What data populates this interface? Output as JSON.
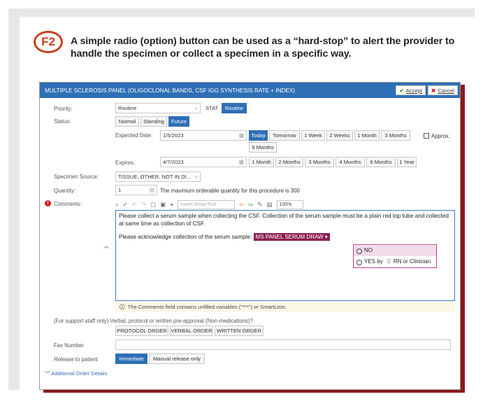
{
  "figure": {
    "badge": "F2",
    "caption": "A simple radio (option) button can be used as a “hard-stop” to alert the provider to handle the specimen or collect a specimen in a specific way."
  },
  "order": {
    "title": "MULTIPLE SCLEROSIS PANEL (OLIGOCLONAL BANDS, CSF IGG SYNTHESIS RATE + INDEX)",
    "accept_label": "Accept",
    "cancel_label": "Cancel",
    "priority": {
      "label": "Priority:",
      "value": "Routine",
      "buttons": [
        "STAT",
        "Routine"
      ],
      "selected": "Routine"
    },
    "status": {
      "label": "Status:",
      "buttons": [
        "Normal",
        "Standing",
        "Future"
      ],
      "selected": "Future"
    },
    "expected_date": {
      "label": "Expected Date:",
      "value": "1/5/2023",
      "quick_buttons": [
        "Today",
        "Tomorrow",
        "1 Week",
        "2 Weeks",
        "1 Month",
        "3 Months",
        "6 Months"
      ],
      "selected": "Today",
      "approx_label": "Approx."
    },
    "expires": {
      "label": "Expires:",
      "value": "4/7/2023",
      "quick_buttons": [
        "1 Month",
        "2 Months",
        "3 Months",
        "4 Months",
        "6 Months",
        "1 Year"
      ]
    },
    "specimen_source": {
      "label": "Specimen Source:",
      "value": "TISSUE, OTHER, NOT IN DI..."
    },
    "quantity": {
      "label": "Quantity:",
      "value": "1",
      "note": "The maximum orderable quantity for this procedure is 300"
    },
    "comments": {
      "label": "Comments:",
      "smarttext_placeholder": "Insert SmartText",
      "zoom": "100%",
      "text1": "Please collect a serum sample when collecting the CSF. Collection of the serum sample must be a plain red top tube and collected at same time as collection of CSF.",
      "text2": "Please acknowledge collection of the serum sample:",
      "smartlist": "MS PANEL SERUM DRAW",
      "options": [
        {
          "label": "NO"
        },
        {
          "label": "YES by",
          "suffix": "RN or Clinician"
        }
      ],
      "warning": "The Comments field contains unfilled variables (\"***\") or SmartLists."
    },
    "support_staff": {
      "label": "(For support staff only) Verbal, protocol or written pre-approval (Non-medications)?",
      "buttons": [
        "PROTOCOL ORDER",
        "VERBAL ORDER",
        "WRITTEN ORDER"
      ]
    },
    "fax": {
      "label": "Fax Number",
      "value": ""
    },
    "release": {
      "label": "Release to patient",
      "buttons": [
        "Immediate",
        "Manual release only"
      ],
      "selected": "Immediate"
    },
    "additional_link": "Additional Order Details"
  },
  "colors": {
    "accent_blue": "#2f6fb6",
    "badge_orange": "#c9411f",
    "smartlist_maroon": "#8c1d53",
    "dropdown_border": "#c43d8a"
  }
}
